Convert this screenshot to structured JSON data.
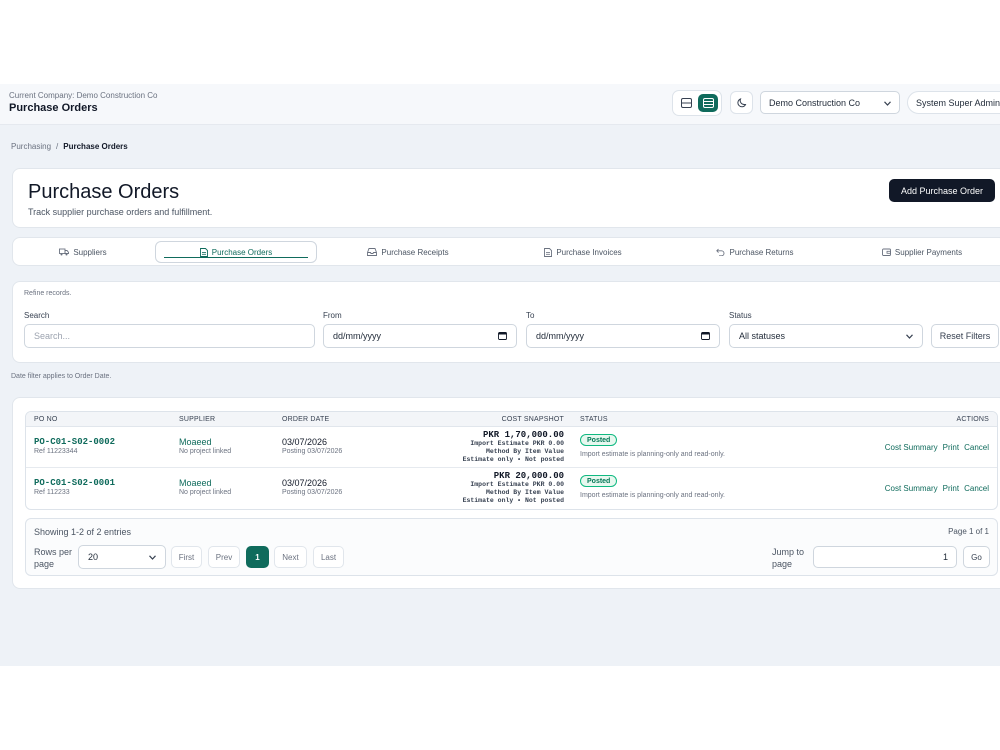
{
  "topbar": {
    "company_label": "Current Company: Demo Construction Co",
    "title": "Purchase Orders",
    "view_toggle_icons": [
      "panel-split-icon",
      "table-view-icon"
    ],
    "theme_icon": "moon-icon",
    "company_select": "Demo Construction Co",
    "user": "System Super Admin"
  },
  "breadcrumb": {
    "parent": "Purchasing",
    "separator": "/",
    "current": "Purchase Orders"
  },
  "hero": {
    "title": "Purchase Orders",
    "subtitle": "Track supplier purchase orders and fulfillment.",
    "add_button": "Add Purchase Order"
  },
  "tabs": [
    {
      "label": "Suppliers",
      "icon": "truck-icon",
      "active": false
    },
    {
      "label": "Purchase Orders",
      "icon": "document-icon",
      "active": true
    },
    {
      "label": "Purchase Receipts",
      "icon": "inbox-icon",
      "active": false
    },
    {
      "label": "Purchase Invoices",
      "icon": "document-icon",
      "active": false
    },
    {
      "label": "Purchase Returns",
      "icon": "undo-icon",
      "active": false
    },
    {
      "label": "Supplier Payments",
      "icon": "wallet-icon",
      "active": false
    }
  ],
  "filters": {
    "refine_text": "Refine records.",
    "search_label": "Search",
    "search_placeholder": "Search...",
    "from_label": "From",
    "from_value": "dd/mm/yyyy",
    "to_label": "To",
    "to_value": "dd/mm/yyyy",
    "status_label": "Status",
    "status_value": "All statuses",
    "reset_button": "Reset Filters",
    "note": "Date filter applies to Order Date."
  },
  "table": {
    "headers": [
      "PO NO",
      "SUPPLIER",
      "ORDER DATE",
      "COST SNAPSHOT",
      "STATUS",
      "ACTIONS"
    ],
    "rows": [
      {
        "po_no": "PO-C01-S02-0002",
        "ref": "Ref 11223344",
        "supplier": "Moaeed",
        "project": "No project linked",
        "order_date": "03/07/2026",
        "posting": "Posting 03/07/2026",
        "cost": "PKR 1,70,000.00",
        "cost_lines": [
          "Import Estimate PKR 0.00",
          "Method By Item Value",
          "Estimate only • Not posted"
        ],
        "status": "Posted",
        "status_note": "Import estimate is planning-only and read-only.",
        "actions": [
          "Cost Summary",
          "Print",
          "Cancel"
        ]
      },
      {
        "po_no": "PO-C01-S02-0001",
        "ref": "Ref 112233",
        "supplier": "Moaeed",
        "project": "No project linked",
        "order_date": "03/07/2026",
        "posting": "Posting 03/07/2026",
        "cost": "PKR 20,000.00",
        "cost_lines": [
          "Import Estimate PKR 0.00",
          "Method By Item Value",
          "Estimate only • Not posted"
        ],
        "status": "Posted",
        "status_note": "Import estimate is planning-only and read-only.",
        "actions": [
          "Cost Summary",
          "Print",
          "Cancel"
        ]
      }
    ]
  },
  "pagination": {
    "showing": "Showing 1-2 of 2 entries",
    "page_of": "Page 1 of 1",
    "rows_label": "Rows per page",
    "rows_value": "20",
    "first": "First",
    "prev": "Prev",
    "current": "1",
    "next": "Next",
    "last": "Last",
    "jump_label": "Jump to page",
    "jump_value": "1",
    "go": "Go"
  },
  "colors": {
    "accent": "#0f6b5c",
    "dark_button": "#111827",
    "posted_badge": "#10b981"
  }
}
